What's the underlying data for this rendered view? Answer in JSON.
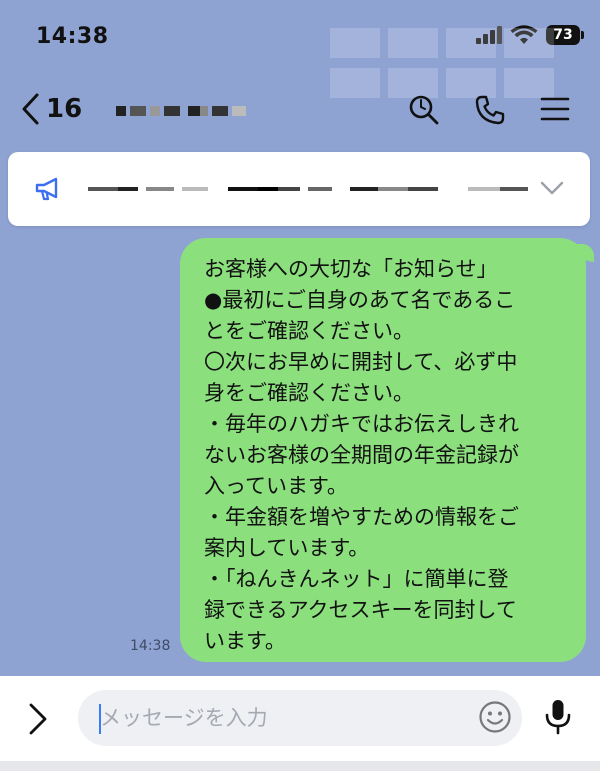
{
  "status_bar": {
    "time": "14:38",
    "battery": "73"
  },
  "header": {
    "unread_count": "16"
  },
  "message": {
    "lines": [
      "お客様への大切な「お知らせ」",
      "●最初にご自身のあて名であるこ",
      "とをご確認ください。",
      "〇次にお早めに開封して、必ず中",
      "身をご確認ください。",
      "・毎年のハガキではお伝えしきれ",
      "ないお客様の全期間の年金記録が",
      "入っています。",
      "・年金額を増やすための情報をご",
      "案内しています。",
      "・「ねんきんネット」に簡単に登",
      "録できるアクセスキーを同封して",
      "います。"
    ],
    "time": "14:38"
  },
  "input": {
    "placeholder": "メッセージを入力"
  },
  "colors": {
    "background": "#8fa3d3",
    "bubble": "#8bdf7d",
    "announcement_icon": "#3b6ff0",
    "caret": "#3b7cf6"
  }
}
